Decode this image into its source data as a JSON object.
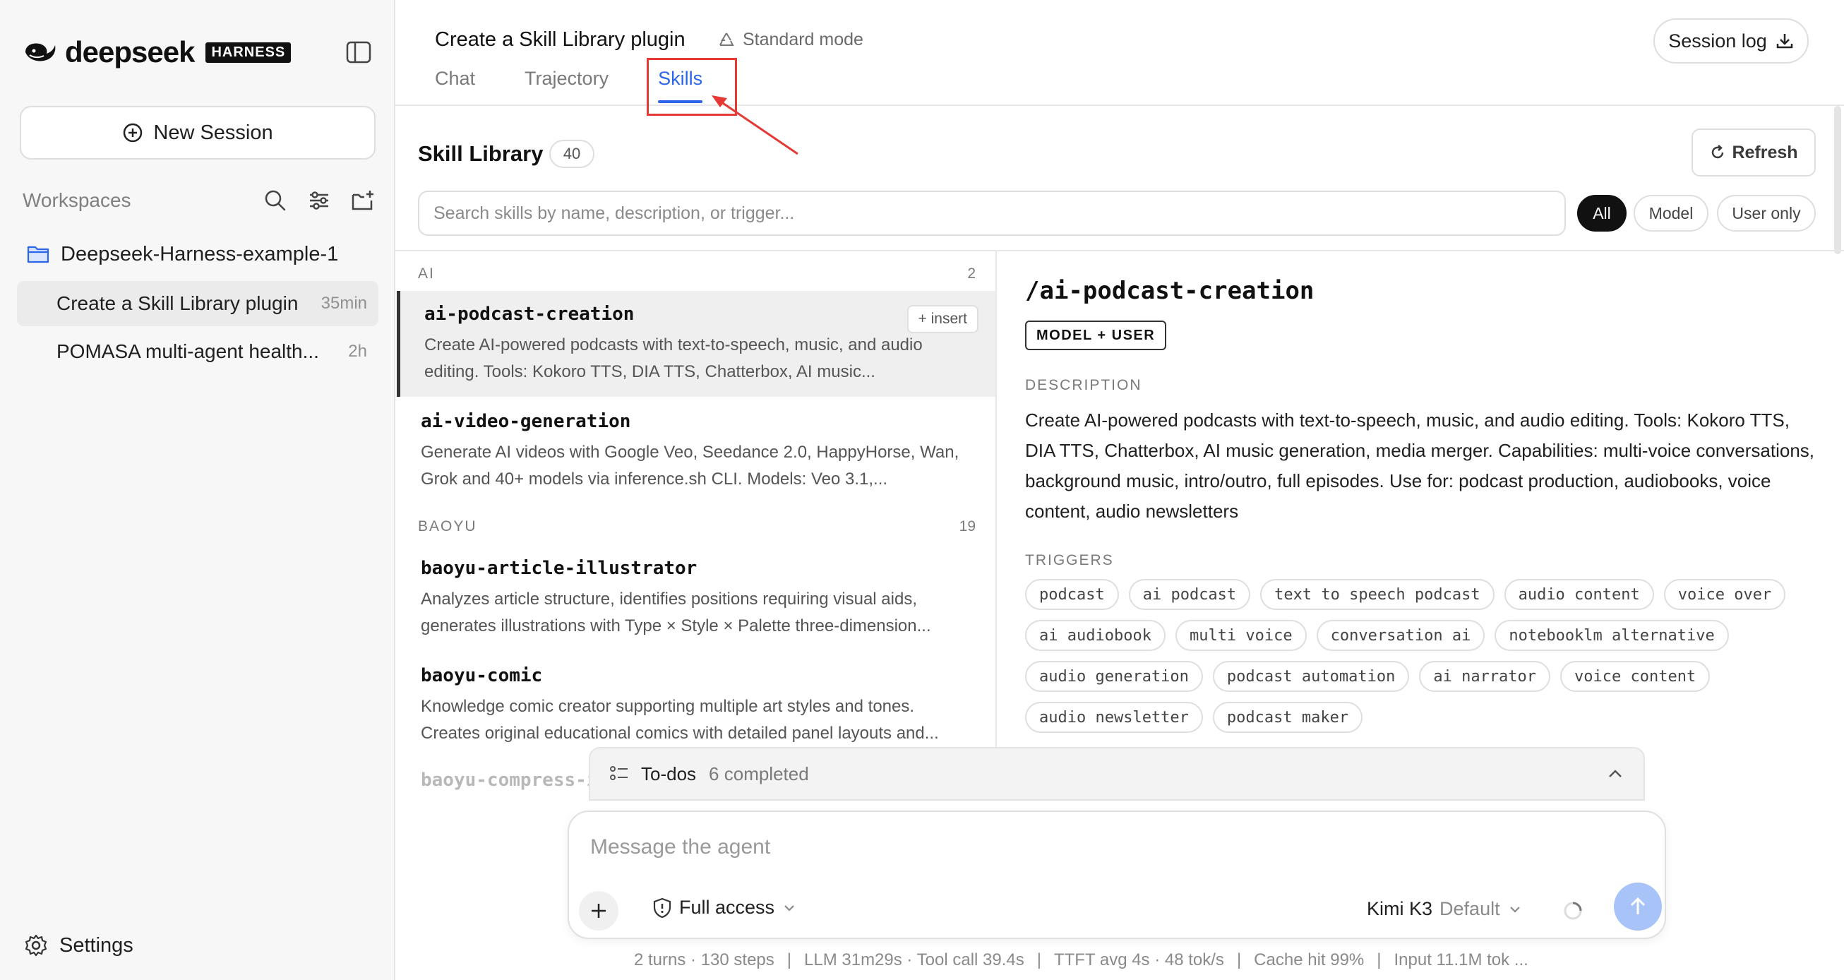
{
  "sidebar": {
    "brand_name": "deepseek",
    "brand_badge": "HARNESS",
    "new_session_label": "New Session",
    "workspaces_title": "Workspaces",
    "workspace_name": "Deepseek-Harness-example-1",
    "sessions": [
      {
        "title": "Create a Skill Library plugin",
        "time": "35min"
      },
      {
        "title": "POMASA multi-agent health...",
        "time": "2h"
      }
    ],
    "settings_label": "Settings"
  },
  "header": {
    "title": "Create a Skill Library plugin",
    "mode": "Standard mode",
    "tabs": [
      {
        "label": "Chat"
      },
      {
        "label": "Trajectory"
      },
      {
        "label": "Skills"
      }
    ],
    "session_log_label": "Session log"
  },
  "library": {
    "title": "Skill Library",
    "count": "40",
    "refresh_label": "Refresh",
    "search_placeholder": "Search skills by name, description, or trigger...",
    "filters": [
      "All",
      "Model",
      "User only"
    ],
    "groups": [
      {
        "name": "AI",
        "count": "2",
        "skills": [
          {
            "name": "ai-podcast-creation",
            "desc": "Create AI-powered podcasts with text-to-speech, music, and audio editing. Tools: Kokoro TTS, DIA TTS, Chatterbox, AI music..."
          },
          {
            "name": "ai-video-generation",
            "desc": "Generate AI videos with Google Veo, Seedance 2.0, HappyHorse, Wan, Grok and 40+ models via inference.sh CLI. Models: Veo 3.1,..."
          }
        ]
      },
      {
        "name": "BAOYU",
        "count": "19",
        "skills": [
          {
            "name": "baoyu-article-illustrator",
            "desc": "Analyzes article structure, identifies positions requiring visual aids, generates illustrations with Type × Style × Palette three-dimension..."
          },
          {
            "name": "baoyu-comic",
            "desc": "Knowledge comic creator supporting multiple art styles and tones. Creates original educational comics with detailed panel layouts and..."
          }
        ]
      }
    ],
    "insert_label": "+ insert",
    "faded_item": "baoyu-compress-i"
  },
  "detail": {
    "title": "/ai-podcast-creation",
    "badge": "MODEL + USER",
    "description_label": "DESCRIPTION",
    "description": "Create AI-powered podcasts with text-to-speech, music, and audio editing. Tools: Kokoro TTS, DIA TTS, Chatterbox, AI music generation, media merger. Capabilities: multi-voice conversations, background music, intro/outro, full episodes. Use for: podcast production, audiobooks, voice content, audio newsletters",
    "triggers_label": "TRIGGERS",
    "triggers": [
      "podcast",
      "ai podcast",
      "text to speech podcast",
      "audio content",
      "voice over",
      "ai audiobook",
      "multi voice",
      "conversation ai",
      "notebooklm alternative",
      "audio generation",
      "podcast automation",
      "ai narrator",
      "voice content",
      "audio newsletter",
      "podcast maker"
    ]
  },
  "todo": {
    "label": "To-dos",
    "count": "6 completed"
  },
  "composer": {
    "placeholder": "Message the agent",
    "access_label": "Full access",
    "model_name": "Kimi K3",
    "model_default": "Default"
  },
  "stats": [
    "2 turns · 130 steps",
    "LLM 31m29s · Tool call 39.4s",
    "TTFT avg 4s · 48 tok/s",
    "Cache hit 99%",
    "Input 11.1M tok ..."
  ],
  "colors": {
    "accent": "#2b66e8",
    "annotation": "#e53935",
    "send_button": "#a7c3f7"
  }
}
